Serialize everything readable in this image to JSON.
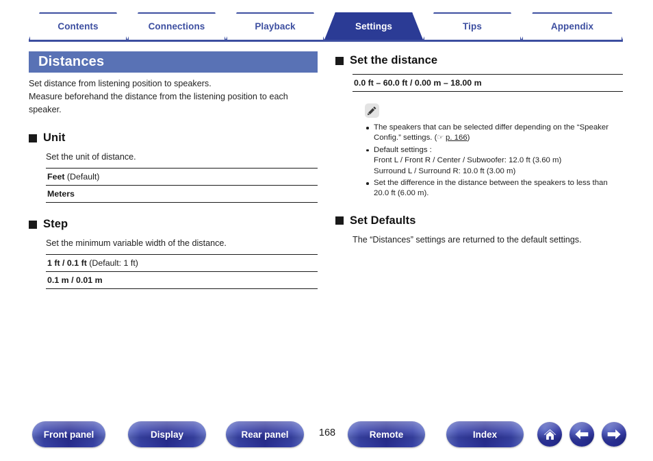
{
  "tabs": [
    {
      "label": "Contents",
      "active": false
    },
    {
      "label": "Connections",
      "active": false
    },
    {
      "label": "Playback",
      "active": false
    },
    {
      "label": "Settings",
      "active": true
    },
    {
      "label": "Tips",
      "active": false
    },
    {
      "label": "Appendix",
      "active": false
    }
  ],
  "page": {
    "title": "Distances",
    "number": "168"
  },
  "intro": {
    "line1": "Set distance from listening position to speakers.",
    "line2": "Measure beforehand the distance from the listening position to each speaker."
  },
  "left_column": {
    "sections": [
      {
        "heading": "Unit",
        "description": "Set the unit of distance.",
        "options": [
          {
            "name": "Feet",
            "note": " (Default)"
          },
          {
            "name": "Meters",
            "note": ""
          }
        ]
      },
      {
        "heading": "Step",
        "description": "Set the minimum variable width of the distance.",
        "options": [
          {
            "name": "1 ft / 0.1 ft",
            "note": " (Default: 1 ft)"
          },
          {
            "name": "0.1 m / 0.01 m",
            "note": ""
          }
        ]
      }
    ]
  },
  "right_column": {
    "set_distance": {
      "heading": "Set the distance",
      "range": "0.0 ft – 60.0 ft / 0.00 m – 18.00 m"
    },
    "note": {
      "icon": "pencil-icon",
      "items": [
        {
          "text": "The speakers that can be selected differ depending on the “Speaker Config.” settings.",
          "xref_hand": "☞",
          "xref_link": "p. 166",
          "sub1": "",
          "sub2": ""
        },
        {
          "text": "Default settings :",
          "xref_hand": "",
          "xref_link": "",
          "sub1": "Front L / Front R / Center / Subwoofer: 12.0 ft (3.60 m)",
          "sub2": "Surround L / Surround R: 10.0 ft (3.00 m)"
        },
        {
          "text": "Set the difference in the distance between the speakers to less than 20.0 ft (6.00 m).",
          "xref_hand": "",
          "xref_link": "",
          "sub1": "",
          "sub2": ""
        }
      ]
    },
    "set_defaults": {
      "heading": "Set Defaults",
      "description": "The “Distances” settings are returned to the default settings."
    }
  },
  "footer": {
    "buttons": [
      {
        "label": "Front panel"
      },
      {
        "label": "Display"
      },
      {
        "label": "Rear panel"
      },
      {
        "label": "Remote"
      },
      {
        "label": "Index"
      }
    ],
    "icons": [
      {
        "name": "home-icon"
      },
      {
        "name": "arrow-left-icon"
      },
      {
        "name": "arrow-right-icon"
      }
    ]
  },
  "colors": {
    "tab_blue": "#3c4ea0",
    "tab_active_blue": "#2b3b95",
    "title_bar_blue": "#5972b5",
    "button_blue": "#2a2f96"
  }
}
